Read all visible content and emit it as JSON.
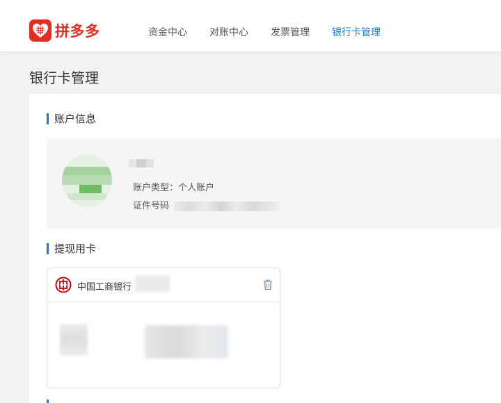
{
  "brand": {
    "name": "拼多多",
    "color": "#e02e24"
  },
  "nav": [
    {
      "label": "资金中心",
      "active": false
    },
    {
      "label": "对账中心",
      "active": false
    },
    {
      "label": "发票管理",
      "active": false
    },
    {
      "label": "银行卡管理",
      "active": true
    }
  ],
  "page": {
    "title": "银行卡管理"
  },
  "account_section": {
    "title": "账户信息",
    "account_type_label": "账户类型：",
    "account_type_value": "个人账户",
    "id_label": "证件号码"
  },
  "withdraw_section": {
    "title": "提现用卡",
    "card": {
      "bank_name": "中国工商银行",
      "bank_icon": "icbc-logo-icon",
      "delete_icon": "trash-icon"
    }
  },
  "colors": {
    "accent": "#1a7ad1",
    "icbc_red": "#c7000b"
  }
}
